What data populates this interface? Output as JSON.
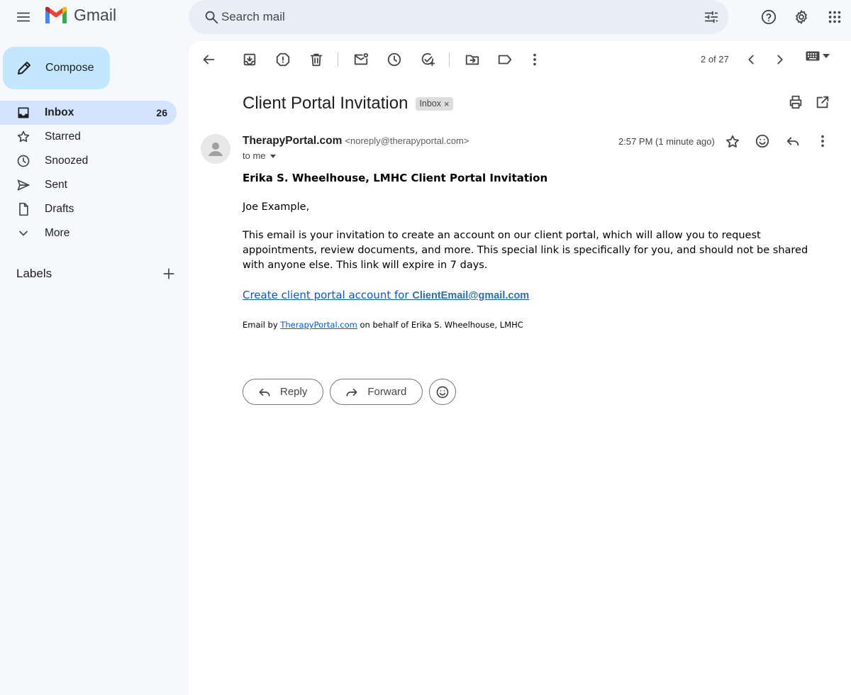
{
  "app": {
    "name": "Gmail"
  },
  "search": {
    "placeholder": "Search mail"
  },
  "compose": {
    "label": "Compose"
  },
  "sidebar": {
    "items": [
      {
        "label": "Inbox",
        "count": "26"
      },
      {
        "label": "Starred"
      },
      {
        "label": "Snoozed"
      },
      {
        "label": "Sent"
      },
      {
        "label": "Drafts"
      },
      {
        "label": "More"
      }
    ],
    "labels_heading": "Labels"
  },
  "toolbar": {
    "pager": "2 of 27"
  },
  "email": {
    "subject": "Client Portal Invitation",
    "chip": "Inbox",
    "chip_close": "×",
    "sender_name": "TherapyPortal.com",
    "sender_email": "<noreply@therapyportal.com>",
    "to": "to me",
    "timestamp": "2:57 PM (1 minute ago)",
    "heading": "Erika S. Wheelhouse, LMHC Client Portal Invitation",
    "greeting": "Joe Example,",
    "paragraph": "This email is your invitation to create an account on our client portal, which will allow you to request appointments, review documents, and more. This special link is specifically for you, and should not be shared with anyone else. This link will expire in 7 days.",
    "cta_text": "Create client portal account for ",
    "cta_email": "ClientEmail@gmail.com",
    "footer_prefix": "Email by ",
    "footer_link": "TherapyPortal.com",
    "footer_suffix": " on behalf of Erika S. Wheelhouse, LMHC"
  },
  "actions": {
    "reply": "Reply",
    "forward": "Forward"
  },
  "colors": {
    "accent": "#c2e7ff",
    "active_nav": "#d3e3fd",
    "link": "#1155cc",
    "background": "#f6f8fc"
  }
}
